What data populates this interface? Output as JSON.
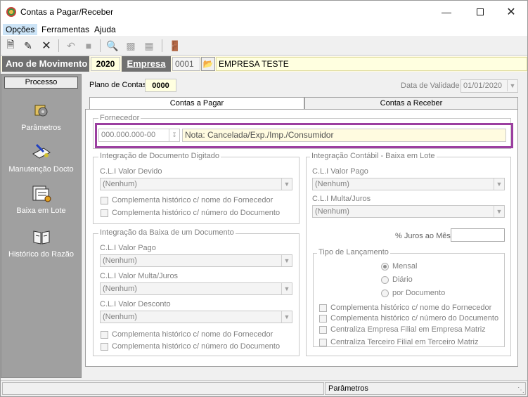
{
  "window": {
    "title": "Contas a Pagar/Receber"
  },
  "menu": [
    "Opções",
    "Ferramentas",
    "Ajuda"
  ],
  "header": {
    "ano_label": "Ano de Movimento",
    "ano_value": "2020",
    "empresa_label": "Empresa",
    "empresa_code": "0001",
    "empresa_name": "EMPRESA TESTE"
  },
  "sidebar": {
    "title": "Processo",
    "items": [
      {
        "label": "Parâmetros",
        "icon": "parametros-icon"
      },
      {
        "label": "Manutenção Docto",
        "icon": "manutencao-icon"
      },
      {
        "label": "Baixa em Lote",
        "icon": "baixa-lote-icon"
      },
      {
        "label": "Histórico do Razão",
        "icon": "historico-icon"
      }
    ]
  },
  "plano": {
    "label": "Plano de Contas",
    "value": "0000"
  },
  "validade": {
    "label": "Data de Validade",
    "value": "01/01/2020"
  },
  "tabs": [
    "Contas a Pagar",
    "Contas a Receber"
  ],
  "fornecedor": {
    "group_label": "Fornecedor",
    "code": "000.000.000-00",
    "note": "Nota: Cancelada/Exp./Imp./Consumidor"
  },
  "integ_doc": {
    "group_label": "Integração de Documento Digitado",
    "field_label": "C.L.I Valor Devido",
    "field_value": "(Nenhum)",
    "chk1": "Complementa histórico c/ nome do Fornecedor",
    "chk2": "Complementa histórico c/ número do Documento"
  },
  "integ_baixa": {
    "group_label": "Integração da Baixa de um Documento",
    "f1_label": "C.L.I Valor Pago",
    "f1_value": "(Nenhum)",
    "f2_label": "C.L.I Valor Multa/Juros",
    "f2_value": "(Nenhum)",
    "f3_label": "C.L.I Valor Desconto",
    "f3_value": "(Nenhum)",
    "chk1": "Complementa histórico c/ nome do Fornecedor",
    "chk2": "Complementa histórico c/ número do Documento"
  },
  "integ_contabil": {
    "group_label": "Integração Contábil - Baixa em Lote",
    "f1_label": "C.L.I Valor Pago",
    "f1_value": "(Nenhum)",
    "f2_label": "C.L.I Multa/Juros",
    "f2_value": "(Nenhum)",
    "juros_label": "% Juros ao Mês",
    "juros_value": ""
  },
  "tipo_lanc": {
    "group_label": "Tipo de Lançamento",
    "options": [
      "Mensal",
      "Diário",
      "por Documento"
    ],
    "selected": "Mensal",
    "chk1": "Complementa histórico c/ nome do Fornecedor",
    "chk2": "Complementa histórico c/ número do Documento",
    "chk3": "Centraliza Empresa Filial em Empresa Matriz",
    "chk4": "Centraliza Terceiro Filial em Terceiro Matriz"
  },
  "status": {
    "right": "Parâmetros"
  },
  "colors": {
    "highlight_border": "#9b3fa0",
    "note_bg": "#fffbe0"
  }
}
